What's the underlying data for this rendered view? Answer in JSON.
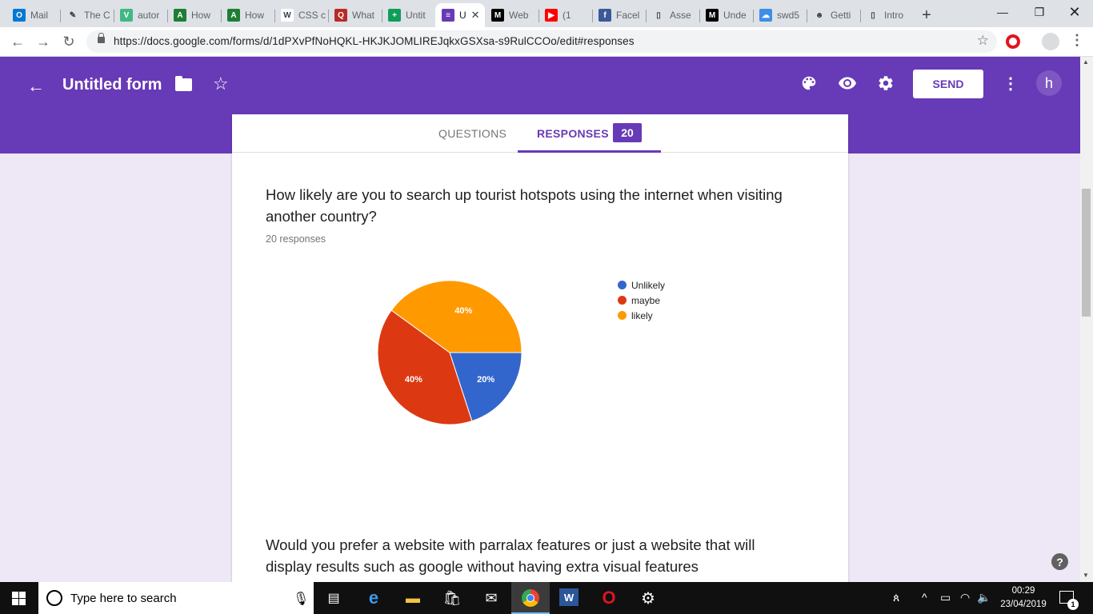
{
  "browser": {
    "tabs": [
      {
        "title": "Mail",
        "icon": "outlook-icon",
        "color": "#0078d4",
        "glyph": "O"
      },
      {
        "title": "The C",
        "icon": "sketch-icon",
        "color": "#dee1e6",
        "glyph": "✎"
      },
      {
        "title": "autor",
        "icon": "vue-icon",
        "color": "#41b883",
        "glyph": "V"
      },
      {
        "title": "How",
        "icon": "codepen-icon",
        "color": "#1e7e34",
        "glyph": "A"
      },
      {
        "title": "How",
        "icon": "codepen-icon",
        "color": "#1e7e34",
        "glyph": "A"
      },
      {
        "title": "CSS c",
        "icon": "wikipedia-icon",
        "color": "#ffffff",
        "glyph": "W"
      },
      {
        "title": "What",
        "icon": "quora-icon",
        "color": "#b92b27",
        "glyph": "Q"
      },
      {
        "title": "Untit",
        "icon": "sheets-icon",
        "color": "#0f9d58",
        "glyph": "+"
      },
      {
        "title": "U",
        "icon": "forms-icon",
        "color": "#673ab7",
        "glyph": "≡",
        "active": true
      },
      {
        "title": "Web",
        "icon": "medium-icon",
        "color": "#000000",
        "glyph": "M"
      },
      {
        "title": "(1",
        "icon": "youtube-icon",
        "color": "#ff0000",
        "glyph": "▶"
      },
      {
        "title": "Facel",
        "icon": "facebook-icon",
        "color": "#3b5998",
        "glyph": "f"
      },
      {
        "title": "Asse",
        "icon": "document-icon",
        "color": "#dee1e6",
        "glyph": "▯"
      },
      {
        "title": "Unde",
        "icon": "medium-icon",
        "color": "#000000",
        "glyph": "M"
      },
      {
        "title": "swd5",
        "icon": "cloud-icon",
        "color": "#3d8ee8",
        "glyph": "☁"
      },
      {
        "title": "Getti",
        "icon": "jenkins-icon",
        "color": "#dee1e6",
        "glyph": "☻"
      },
      {
        "title": "Intro",
        "icon": "document-icon",
        "color": "#dee1e6",
        "glyph": "▯"
      }
    ],
    "url": "https://docs.google.com/forms/d/1dPXvPfNoHQKL-HKJKJOMLIREJqkxGSXsa-s9RulCCOo/edit#responses"
  },
  "header": {
    "title": "Untitled form",
    "send_label": "SEND",
    "avatar_initial": "h",
    "background": "#673ab7"
  },
  "tabs": {
    "questions": "QUESTIONS",
    "responses": "RESPONSES",
    "response_count": "20"
  },
  "question1": {
    "text": "How likely are you to search up tourist hotspots using the internet when visiting another country?",
    "responses_label": "20 responses"
  },
  "chart_data": {
    "type": "pie",
    "categories": [
      "Unlikely",
      "maybe",
      "likely"
    ],
    "values": [
      20,
      40,
      40
    ],
    "labels": [
      "20%",
      "40%",
      "40%"
    ],
    "colors": [
      "#3366cc",
      "#dc3912",
      "#ff9900"
    ],
    "legend": "right"
  },
  "question2": {
    "text": "Would you prefer a website with parralax features or just a website that will display results such as google without having extra visual features"
  },
  "taskbar": {
    "search_placeholder": "Type here to search",
    "time": "00:29",
    "date": "23/04/2019",
    "notification_count": "1"
  }
}
